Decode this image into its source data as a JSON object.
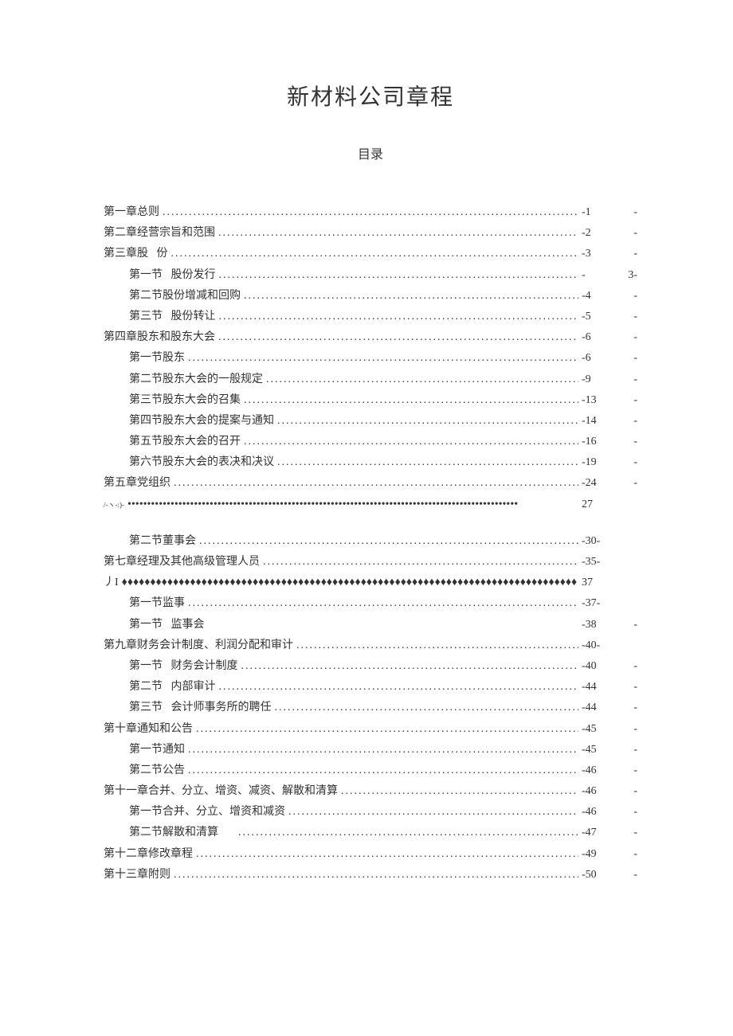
{
  "title": "新材料公司章程",
  "subtitle": "目录",
  "toc": [
    {
      "level": 1,
      "label": "第一章总则",
      "page": "-1",
      "trail": "-"
    },
    {
      "level": 1,
      "label": "第二章经营宗旨和范围",
      "page": "-2",
      "trail": "-"
    },
    {
      "level": 1,
      "label": "第三章股",
      "extra": "份",
      "page": "-3",
      "trail": "-",
      "spaced": true
    },
    {
      "level": 2,
      "label": "第一节",
      "extra": "股份发行",
      "page": "-",
      "trail": "3-",
      "spaced": true
    },
    {
      "level": 2,
      "label": "第二节股份增减和回购",
      "page": "-4",
      "trail": "-"
    },
    {
      "level": 2,
      "label": "第三节",
      "extra": "股份转让",
      "page": "-5",
      "trail": "-",
      "spaced": true
    },
    {
      "level": 1,
      "label": "第四章股东和股东大会",
      "page": "-6",
      "trail": "-"
    },
    {
      "level": 2,
      "label": "第一节股东",
      "page": "-6",
      "trail": "-"
    },
    {
      "level": 2,
      "label": "第二节股东大会的一般规定",
      "page": "-9",
      "trail": "-"
    },
    {
      "level": 2,
      "label": "第三节股东大会的召集",
      "page": "-13",
      "trail": "-"
    },
    {
      "level": 2,
      "label": "第四节股东大会的提案与通知",
      "page": "-14",
      "trail": "-"
    },
    {
      "level": 2,
      "label": "第五节股东大会的召开",
      "page": "-16",
      "trail": "-"
    },
    {
      "level": 2,
      "label": "第六节股东大会的表决和决议",
      "page": "-19",
      "trail": "-"
    },
    {
      "level": 1,
      "label": "第五章党组织",
      "page": "-24",
      "trail": "-"
    },
    {
      "level": 0,
      "special": "bullets",
      "label": "/-ヽ-:)-",
      "page": "27",
      "trail": ""
    },
    {
      "gap": true
    },
    {
      "level": 2,
      "label": "第二节董事会",
      "page": "-30-",
      "trail": ""
    },
    {
      "level": 1,
      "label": "第七章经理及其他高级管理人员",
      "page": "-35-",
      "trail": ""
    },
    {
      "level": 0,
      "special": "diamonds",
      "label": " 丿I",
      "page": "37",
      "trail": ""
    },
    {
      "level": 2,
      "label": "第一节监事",
      "page": "-37-",
      "trail": ""
    },
    {
      "level": 2,
      "label": "第一节",
      "extra": "监事会",
      "page": "-38",
      "trail": "-",
      "nodots": true,
      "spaced": true
    },
    {
      "level": 1,
      "label": "第九章财务会计制度、利润分配和审计",
      "page": "-40-",
      "trail": ""
    },
    {
      "level": 2,
      "label": "第一节",
      "extra": "财务会计制度",
      "page": "-40",
      "trail": "-",
      "spaced": true
    },
    {
      "level": 2,
      "label": "第二节",
      "extra": "内部审计",
      "page": "-44",
      "trail": "-",
      "spaced": true
    },
    {
      "level": 2,
      "label": "第三节",
      "extra": "会计师事务所的聘任",
      "page": "-44",
      "trail": "-",
      "spaced": true
    },
    {
      "level": 1,
      "label": "第十章通知和公告",
      "page": "-45",
      "trail": "-"
    },
    {
      "level": 2,
      "label": "第一节通知",
      "page": "-45",
      "trail": "-"
    },
    {
      "level": 2,
      "label": "第二节公告",
      "page": "-46",
      "trail": "-"
    },
    {
      "level": 1,
      "label": "第十一章合并、分立、增资、减资、解散和清算",
      "page": "-46",
      "trail": "-"
    },
    {
      "level": 2,
      "label": "第一节合并、分立、增资和减资",
      "page": "-46",
      "trail": "-"
    },
    {
      "level": 2,
      "label": "第二节解散和清算",
      "page": "-47",
      "trail": "-",
      "gap_before_dots": true
    },
    {
      "level": 1,
      "label": "第十二章修改章程",
      "page": "-49",
      "trail": "-"
    },
    {
      "level": 1,
      "label": "第十三章附则",
      "page": "-50",
      "trail": "-"
    }
  ]
}
